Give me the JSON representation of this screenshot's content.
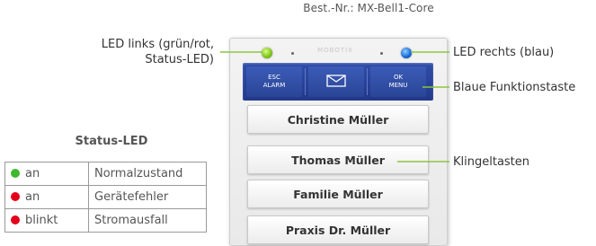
{
  "part_number": "Best.-Nr.: MX-Bell1-Core",
  "device": {
    "brand": "MOBOTIX",
    "function_keys": [
      {
        "line1": "ESC",
        "line2": "ALARM"
      },
      {
        "icon": "envelope-icon"
      },
      {
        "line1": "OK",
        "line2": "MENU"
      }
    ],
    "bell_buttons": [
      "Christine Müller",
      "Thomas Müller",
      "Familie Müller",
      "Praxis Dr. Müller"
    ],
    "colors": {
      "led_left": "#7cc11a",
      "led_right": "#1566d8",
      "function_bar": "#22388a",
      "callout_line": "#8cc63f"
    }
  },
  "callouts": {
    "led_left_line1": "LED links (grün/rot,",
    "led_left_line2": "Status-LED)",
    "led_right": "LED rechts (blau)",
    "function_key": "Blaue Funktionstaste",
    "bell_keys": "Klingeltasten"
  },
  "status_table": {
    "title": "Status-LED",
    "rows": [
      {
        "dot_color": "#3fb82f",
        "state": "an",
        "meaning": "Normalzustand"
      },
      {
        "dot_color": "#e3001b",
        "state": "an",
        "meaning": "Gerätefehler"
      },
      {
        "dot_color": "#e3001b",
        "state": "blinkt",
        "meaning": "Stromausfall"
      }
    ]
  }
}
